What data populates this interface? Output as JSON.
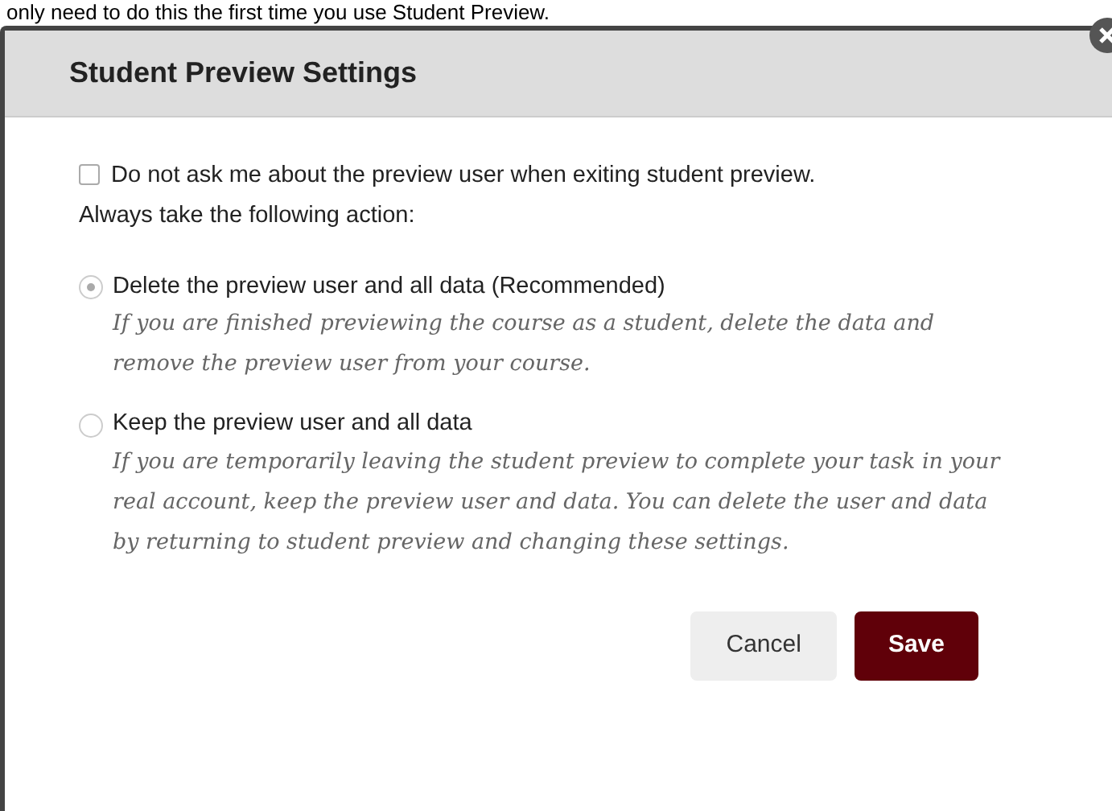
{
  "background_text": "only need to do this the first time you use Student Preview.",
  "dialog": {
    "title": "Student Preview Settings",
    "checkbox": {
      "label": "Do not ask me about the preview user when exiting student preview.",
      "checked": false
    },
    "instruction": "Always take the following action:",
    "options": [
      {
        "label": "Delete the preview user and all data (Recommended)",
        "description": "If you are finished previewing the course as a student, delete the data and remove the preview user from your course.",
        "selected": true
      },
      {
        "label": "Keep the preview user and all data",
        "description": "If you are temporarily leaving the student preview to complete your task in your real account, keep the preview user and data. You can delete the user and data by returning to student preview and changing these settings.",
        "selected": false
      }
    ],
    "buttons": [
      {
        "label": "Cancel",
        "kind": "secondary"
      },
      {
        "label": "Save",
        "kind": "primary"
      }
    ]
  }
}
